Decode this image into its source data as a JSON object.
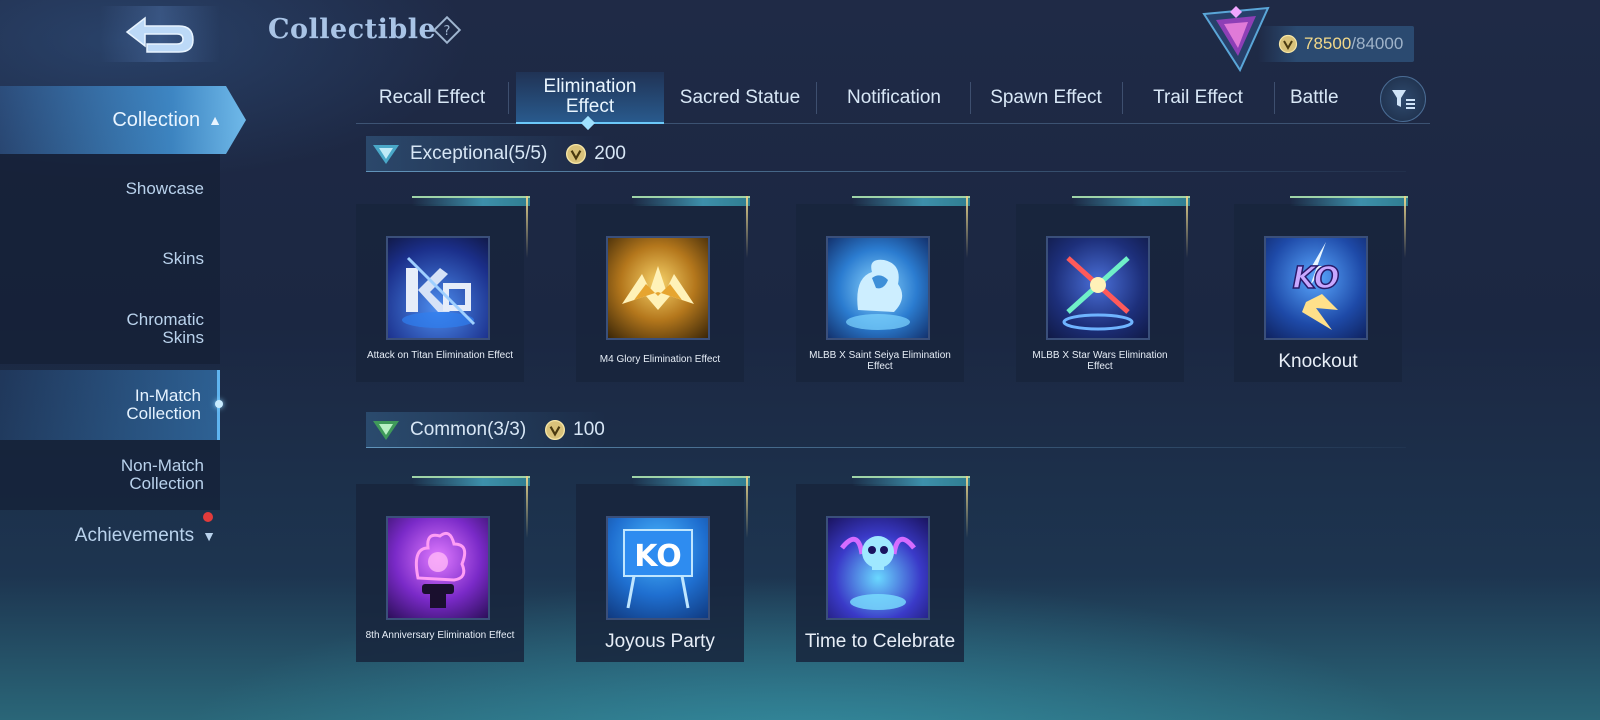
{
  "header": {
    "title": "Collectible",
    "currency_current": "78500",
    "currency_sep_max": "/84000"
  },
  "sidebar": {
    "collection": "Collection",
    "items": [
      {
        "label": "Showcase"
      },
      {
        "label": "Skins"
      },
      {
        "label": "Chromatic Skins"
      },
      {
        "label": "In-Match Collection"
      },
      {
        "label": "Non-Match Collection"
      }
    ],
    "achievements": "Achievements"
  },
  "tabs": [
    {
      "label": "Recall Effect"
    },
    {
      "label": "Elimination Effect"
    },
    {
      "label": "Sacred Statue"
    },
    {
      "label": "Notification"
    },
    {
      "label": "Spawn Effect"
    },
    {
      "label": "Trail Effect"
    },
    {
      "label": "Battle"
    }
  ],
  "sections": {
    "exceptional": {
      "title": "Exceptional(5/5)",
      "points": "200",
      "items": [
        {
          "name": "Attack on Titan Elimination Effect"
        },
        {
          "name": "M4 Glory Elimination Effect"
        },
        {
          "name": "MLBB X Saint Seiya Elimination Effect"
        },
        {
          "name": "MLBB X Star Wars Elimination Effect"
        },
        {
          "name": "Knockout"
        }
      ]
    },
    "common": {
      "title": "Common(3/3)",
      "points": "100",
      "items": [
        {
          "name": "8th Anniversary Elimination Effect"
        },
        {
          "name": "Joyous Party"
        },
        {
          "name": "Time to Celebrate"
        }
      ]
    }
  },
  "art_text": {
    "knockout": "KO",
    "joyous": "KO"
  }
}
